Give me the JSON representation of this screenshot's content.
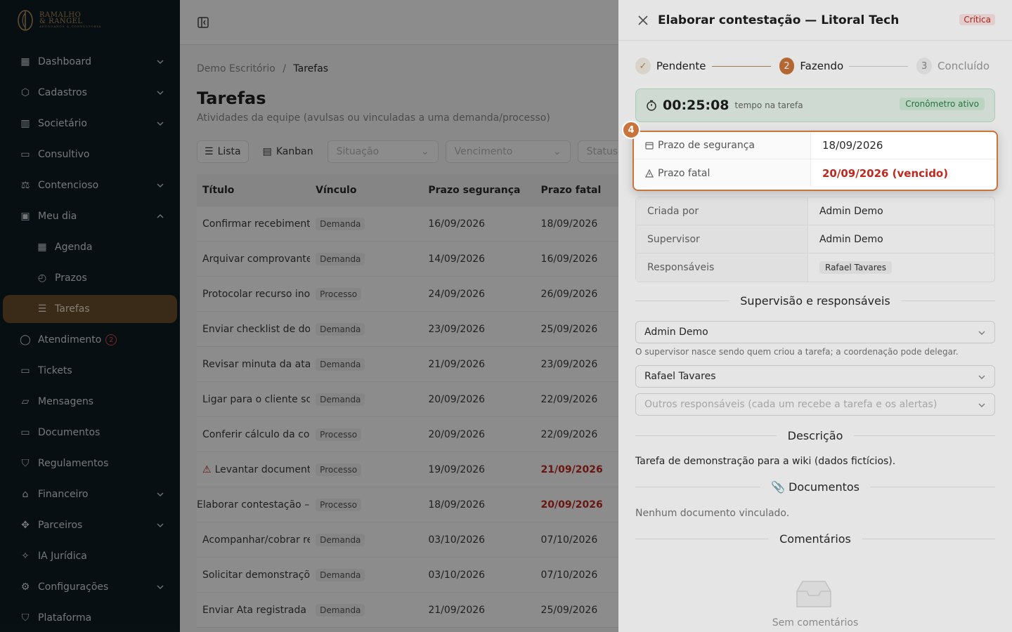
{
  "brand": {
    "line1": "RAMALHO",
    "line2": "& RANGEL",
    "tagline": "ADVOGADOS & CONSULTORIA"
  },
  "sidebar": {
    "items": [
      {
        "label": "Dashboard",
        "icon": "dashboard-icon",
        "chevron": "down"
      },
      {
        "label": "Cadastros",
        "icon": "cubes-icon",
        "chevron": "down"
      },
      {
        "label": "Societário",
        "icon": "building-icon",
        "chevron": "down"
      },
      {
        "label": "Consultivo",
        "icon": "book-icon",
        "chevron": ""
      },
      {
        "label": "Contencioso",
        "icon": "scale-icon",
        "chevron": "down"
      },
      {
        "label": "Meu dia",
        "icon": "calendar-check-icon",
        "chevron": "up"
      },
      {
        "label": "Agenda",
        "icon": "calendar-icon",
        "sub": true
      },
      {
        "label": "Prazos",
        "icon": "calendar-clock-icon",
        "sub": true
      },
      {
        "label": "Tarefas",
        "icon": "list-check-icon",
        "sub": true,
        "active": true
      },
      {
        "label": "Atendimento",
        "icon": "chat-icon",
        "badge": "2"
      },
      {
        "label": "Tickets",
        "icon": "ticket-icon"
      },
      {
        "label": "Mensagens",
        "icon": "message-icon"
      },
      {
        "label": "Documentos",
        "icon": "folder-icon"
      },
      {
        "label": "Regulamentos",
        "icon": "shield-icon"
      },
      {
        "label": "Financeiro",
        "icon": "bank-icon",
        "chevron": "down"
      },
      {
        "label": "Parceiros",
        "icon": "handshake-icon",
        "chevron": "down"
      },
      {
        "label": "IA Jurídica",
        "icon": "sparkles-icon"
      },
      {
        "label": "Configurações",
        "icon": "gear-icon",
        "chevron": "down"
      },
      {
        "label": "Plataforma",
        "icon": "shield-check-icon"
      }
    ]
  },
  "main": {
    "breadcrumb": {
      "root": "Demo Escritório",
      "sep": "/",
      "current": "Tarefas"
    },
    "title": "Tarefas",
    "subtitle": "Atividades da equipe (avulsas ou vinculadas a uma demanda/processo)",
    "views": {
      "list": "Lista",
      "kanban": "Kanban"
    },
    "filters": {
      "situacao": "Situação",
      "vencimento": "Vencimento",
      "status": "Status"
    },
    "columns": {
      "titulo": "Título",
      "vinculo": "Vínculo",
      "seguranca": "Prazo segurança",
      "fatal": "Prazo fatal"
    },
    "rows": [
      {
        "titulo": "Confirmar recebimento",
        "vinculo": "Demanda",
        "seg": "16/09/2026",
        "fatal": "18/09/2026"
      },
      {
        "titulo": "Arquivar comprovante",
        "vinculo": "Demanda",
        "seg": "14/09/2026",
        "fatal": "16/09/2026"
      },
      {
        "titulo": "Protocolar recurso ino",
        "vinculo": "Processo",
        "seg": "24/09/2026",
        "fatal": "26/09/2026"
      },
      {
        "titulo": "Enviar checklist de do",
        "vinculo": "Demanda",
        "seg": "23/09/2026",
        "fatal": "25/09/2026"
      },
      {
        "titulo": "Revisar minuta da ata",
        "vinculo": "Demanda",
        "seg": "21/09/2026",
        "fatal": "23/09/2026"
      },
      {
        "titulo": "Ligar para o cliente sc",
        "vinculo": "Demanda",
        "seg": "20/09/2026",
        "fatal": "22/09/2026"
      },
      {
        "titulo": "Conferir cálculo da co",
        "vinculo": "Processo",
        "seg": "20/09/2026",
        "fatal": "22/09/2026"
      },
      {
        "titulo": "Levantar document",
        "vinculo": "Processo",
        "seg": "19/09/2026",
        "fatal": "21/09/2026",
        "warn": true
      },
      {
        "titulo": "Elaborar contestação –",
        "vinculo": "Processo",
        "seg": "18/09/2026",
        "fatal": "20/09/2026",
        "overdue": true
      },
      {
        "titulo": "Acompanhar/cobrar re",
        "vinculo": "Demanda",
        "seg": "03/10/2026",
        "fatal": "07/10/2026"
      },
      {
        "titulo": "Solicitar demonstraçõ",
        "vinculo": "Demanda",
        "seg": "03/10/2026",
        "fatal": "07/10/2026"
      },
      {
        "titulo": "Enviar Ata registrada a",
        "vinculo": "Demanda",
        "seg": "21/09/2026",
        "fatal": "25/09/2026"
      }
    ]
  },
  "drawer": {
    "title": "Elaborar contestação — Litoral Tech",
    "priority": "Crítica",
    "steps": [
      {
        "num": "1",
        "label": "Pendente",
        "state": "done"
      },
      {
        "num": "2",
        "label": "Fazendo",
        "state": "current"
      },
      {
        "num": "3",
        "label": "Concluído",
        "state": "todo"
      }
    ],
    "timer": {
      "value": "00:25:08",
      "caption": "tempo na tarefa",
      "status": "Cronômetro ativo"
    },
    "deadlines": {
      "badge": "4",
      "seguranca_label": "Prazo de segurança",
      "seguranca_value": "18/09/2026",
      "fatal_label": "Prazo fatal",
      "fatal_value": "20/09/2026 (vencido)"
    },
    "info": [
      {
        "key": "Criada por",
        "value": "Admin Demo"
      },
      {
        "key": "Supervisor",
        "value": "Admin Demo"
      },
      {
        "key": "Responsáveis",
        "value": "Rafael Tavares",
        "chip": true
      }
    ],
    "sections": {
      "supervisao": "Supervisão e responsáveis",
      "descricao": "Descrição",
      "documentos": "Documentos",
      "comentarios": "Comentários"
    },
    "supervisor_select": "Admin Demo",
    "supervisor_hint": "O supervisor nasce sendo quem criou a tarefa; a coordenação pode delegar.",
    "responsavel_select": "Rafael Tavares",
    "outros_placeholder": "Outros responsáveis (cada um recebe a tarefa e os alertas)",
    "description": "Tarefa de demonstração para a wiki (dados fictícios).",
    "no_docs": "Nenhum documento vinculado.",
    "no_comments": "Sem comentários"
  }
}
